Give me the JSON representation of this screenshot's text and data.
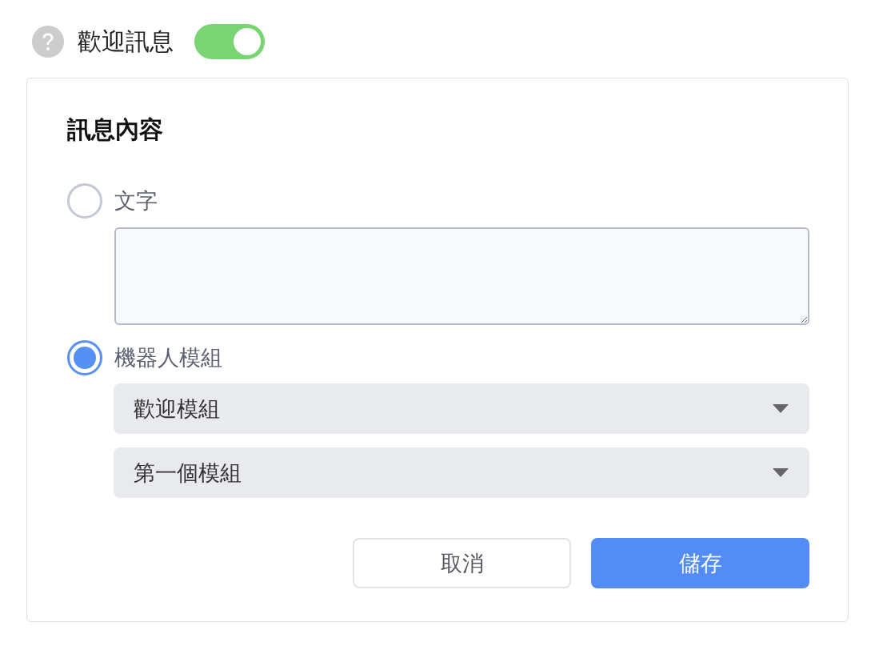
{
  "header": {
    "title": "歡迎訊息",
    "toggle": {
      "on": true
    }
  },
  "card": {
    "title": "訊息內容",
    "options": [
      {
        "kind": "text",
        "label": "文字",
        "selected": false
      },
      {
        "kind": "module",
        "label": "機器人模組",
        "selected": true,
        "selects": [
          {
            "value": "歡迎模組"
          },
          {
            "value": "第一個模組"
          }
        ]
      }
    ],
    "buttons": [
      {
        "kind": "secondary",
        "label": "取消"
      },
      {
        "kind": "primary",
        "label": "儲存"
      }
    ]
  }
}
